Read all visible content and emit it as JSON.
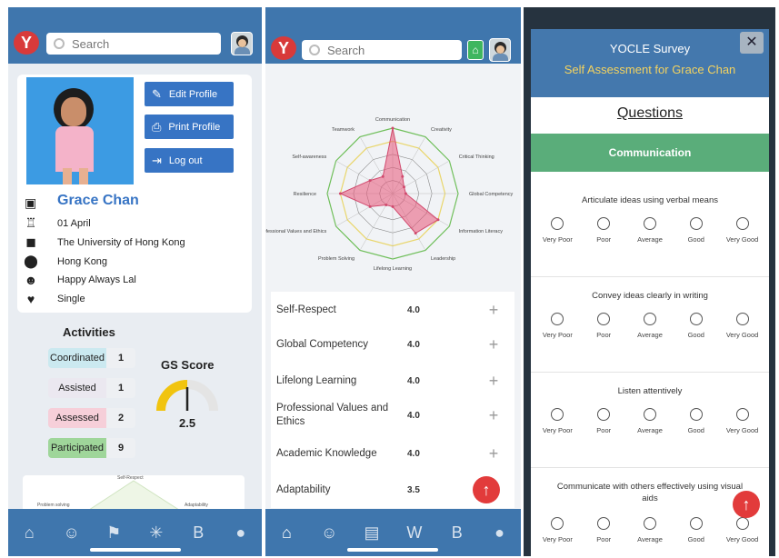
{
  "common": {
    "search_placeholder": "Search",
    "logo": "Y"
  },
  "profile": {
    "buttons": {
      "edit": "Edit Profile",
      "print": "Print Profile",
      "logout": "Log out"
    },
    "name": "Grace Chan",
    "info": [
      {
        "icon": "cake-icon",
        "text": "01 April"
      },
      {
        "icon": "briefcase-icon",
        "text": "The University of Hong Kong"
      },
      {
        "icon": "location-pin-icon",
        "text": "Hong Kong"
      },
      {
        "icon": "smiley-icon",
        "text": "Happy Always Lal"
      },
      {
        "icon": "heart-icon",
        "text": "Single"
      }
    ],
    "activities_title": "Activities",
    "activities": [
      {
        "label": "Coordinated",
        "count": "1",
        "color": "#cbe9f0"
      },
      {
        "label": "Assisted",
        "count": "1",
        "color": "#ebe8f0"
      },
      {
        "label": "Assessed",
        "count": "2",
        "color": "#f6cfd9"
      },
      {
        "label": "Participated",
        "count": "9",
        "color": "#9fd69a"
      }
    ],
    "gs_title": "GS Score",
    "gs_value": "2.5",
    "gs_fraction": 0.5,
    "mini_labels": {
      "top": "Self-Respect",
      "left": "Problem solving",
      "right": "Adaptability"
    }
  },
  "radar": {
    "labels": [
      "Communication",
      "Creativity",
      "Critical Thinking",
      "Global Competency",
      "Information Literacy",
      "Leadership",
      "Lifelong Learning",
      "Problem Solving",
      "Professional Values and Ethics",
      "Resilience",
      "Self-awareness",
      "Teamwork"
    ],
    "values": [
      5,
      1.5,
      1,
      1,
      4,
      3.5,
      1,
      1,
      2,
      4,
      2,
      1.5
    ],
    "max": 5
  },
  "skills": [
    {
      "name": "Self-Respect",
      "value": "4.0"
    },
    {
      "name": "Global Competency",
      "value": "4.0"
    },
    {
      "name": "Lifelong Learning",
      "value": "4.0"
    },
    {
      "name": "Professional Values and Ethics",
      "value": "4.0"
    },
    {
      "name": "Academic Knowledge",
      "value": "4.0"
    },
    {
      "name": "Adaptability",
      "value": "3.5"
    }
  ],
  "survey": {
    "title": "YOCLE Survey",
    "subtitle": "Self Assessment for Grace Chan",
    "questions_heading": "Questions",
    "section": "Communication",
    "options": [
      "Very Poor",
      "Poor",
      "Average",
      "Good",
      "Very Good"
    ],
    "questions": [
      "Articulate ideas using verbal means",
      "Convey ideas clearly in writing",
      "Listen attentively",
      "Communicate with others effectively using visual aids"
    ]
  },
  "colors": {
    "brand_blue": "#3f76ad",
    "accent_red": "#e23b3b",
    "section_green": "#5aad7a"
  }
}
